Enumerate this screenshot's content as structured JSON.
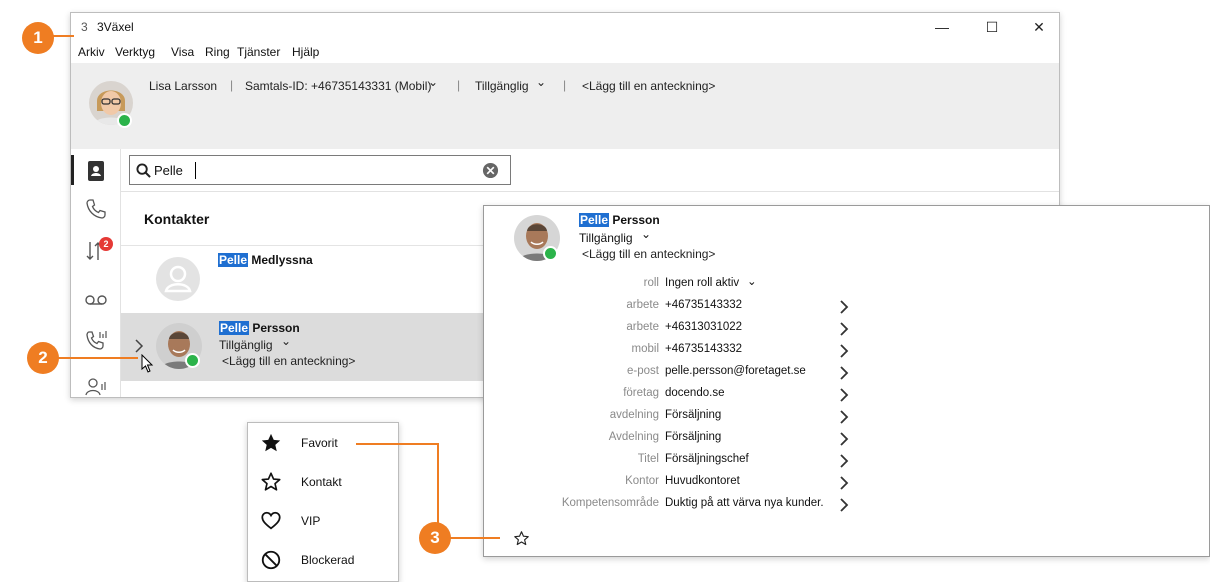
{
  "window": {
    "app_icon": "3",
    "title": "3Växel",
    "controls": {
      "minimize": "—",
      "maximize": "☐",
      "close": "✕"
    }
  },
  "menu": [
    "Arkiv",
    "Verktyg",
    "Visa",
    "Ring",
    "Tjänster",
    "Hjälp"
  ],
  "userbar": {
    "name": "Lisa Larsson",
    "call_id": "Samtals-ID: +46735143331 (Mobil)",
    "status": "Tillgänglig",
    "note": "<Lägg till en anteckning>",
    "separator": "|",
    "chevron": "⌄"
  },
  "nav": {
    "items": [
      "contacts-icon",
      "phone-icon",
      "call-log-icon",
      "voicemail-icon",
      "call-queue-icon",
      "user-queue-icon"
    ],
    "badge": "2"
  },
  "search": {
    "value": "Pelle"
  },
  "section_title": "Kontakter",
  "contacts": [
    {
      "highlight": "Pelle",
      "rest": " Medlyssna"
    },
    {
      "highlight": "Pelle",
      "rest": " Persson",
      "status": "Tillgänglig",
      "note": "<Lägg till en anteckning>"
    }
  ],
  "card": {
    "name_highlight": "Pelle",
    "name_rest": " Persson",
    "status": "Tillgänglig",
    "note": "<Lägg till en anteckning>",
    "fields": [
      {
        "label": "roll",
        "value": "Ingen roll aktiv",
        "dropdown": "⌄"
      },
      {
        "label": "arbete",
        "value": "+46735143332"
      },
      {
        "label": "arbete",
        "value": "+46313031022"
      },
      {
        "label": "mobil",
        "value": "+46735143332"
      },
      {
        "label": "e-post",
        "value": "pelle.persson@foretaget.se"
      },
      {
        "label": "företag",
        "value": "docendo.se"
      },
      {
        "label": "avdelning",
        "value": "Försäljning"
      },
      {
        "label": "Avdelning",
        "value": "Försäljning"
      },
      {
        "label": "Titel",
        "value": "Försäljningschef"
      },
      {
        "label": "Kontor",
        "value": "Huvudkontoret"
      },
      {
        "label": "Kompetensområde",
        "value": "Duktig på att värva nya kunder."
      }
    ]
  },
  "context_menu": [
    {
      "label": "Favorit",
      "icon": "star-filled-icon"
    },
    {
      "label": "Kontakt",
      "icon": "star-outline-icon"
    },
    {
      "label": "VIP",
      "icon": "heart-icon"
    },
    {
      "label": "Blockerad",
      "icon": "blocked-icon"
    }
  ],
  "callouts": [
    "1",
    "2",
    "3"
  ],
  "colors": {
    "accent": "#ef7d22",
    "highlight": "#1f6fd1",
    "status_green": "#2bb34a",
    "badge_red": "#e53935"
  }
}
